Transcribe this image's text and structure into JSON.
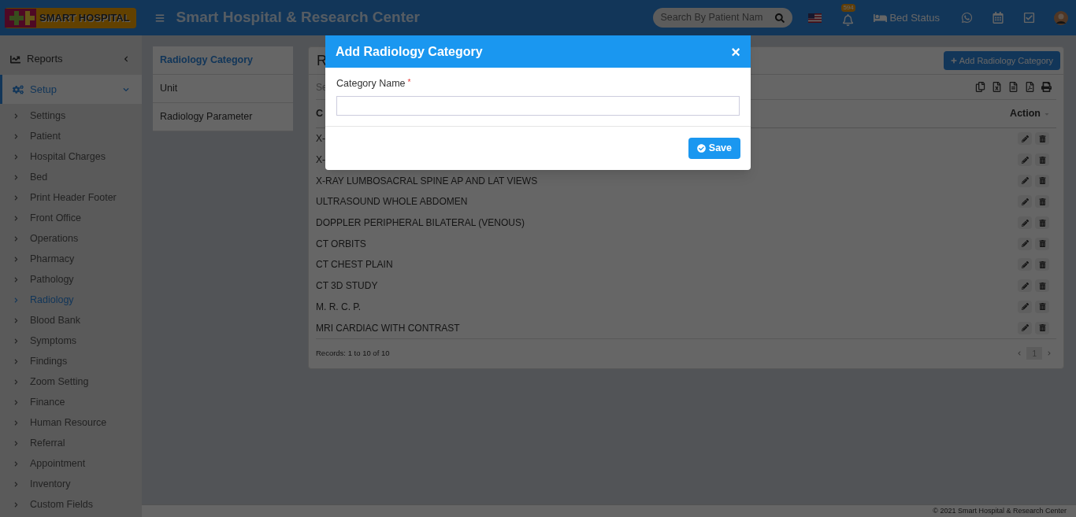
{
  "header": {
    "logo": "SMART HOSPITAL",
    "title": "Smart Hospital & Research Center",
    "search": {
      "placeholder": "Search By Patient Nam"
    },
    "notification_count": "594",
    "bed_status": "Bed Status"
  },
  "sidebar": {
    "items": [
      {
        "label": "Reports",
        "expanded": false,
        "selected": false
      },
      {
        "label": "Setup",
        "expanded": true,
        "selected": true,
        "children": [
          {
            "label": "Settings",
            "selected": false
          },
          {
            "label": "Patient",
            "selected": false
          },
          {
            "label": "Hospital Charges",
            "selected": false
          },
          {
            "label": "Bed",
            "selected": false
          },
          {
            "label": "Print Header Footer",
            "selected": false
          },
          {
            "label": "Front Office",
            "selected": false
          },
          {
            "label": "Operations",
            "selected": false
          },
          {
            "label": "Pharmacy",
            "selected": false
          },
          {
            "label": "Pathology",
            "selected": false
          },
          {
            "label": "Radiology",
            "selected": true
          },
          {
            "label": "Blood Bank",
            "selected": false
          },
          {
            "label": "Symptoms",
            "selected": false
          },
          {
            "label": "Findings",
            "selected": false
          },
          {
            "label": "Zoom Setting",
            "selected": false
          },
          {
            "label": "Finance",
            "selected": false
          },
          {
            "label": "Human Resource",
            "selected": false
          },
          {
            "label": "Referral",
            "selected": false
          },
          {
            "label": "Appointment",
            "selected": false
          },
          {
            "label": "Inventory",
            "selected": false
          },
          {
            "label": "Custom Fields",
            "selected": false
          }
        ]
      }
    ]
  },
  "submenu": [
    {
      "label": "Radiology Category",
      "selected": true
    },
    {
      "label": "Unit",
      "selected": false
    },
    {
      "label": "Radiology Parameter",
      "selected": false
    }
  ],
  "panel": {
    "title": "R",
    "add_button": "Add Radiology Category",
    "search_placeholder": "Se",
    "columns": [
      "C",
      "Action"
    ],
    "rows": [
      {
        "name": "X-"
      },
      {
        "name": "X-"
      },
      {
        "name": "X-RAY LUMBOSACRAL SPINE AP AND LAT VIEWS"
      },
      {
        "name": "ULTRASOUND WHOLE ABDOMEN"
      },
      {
        "name": "DOPPLER PERIPHERAL BILATERAL (VENOUS)"
      },
      {
        "name": "CT ORBITS"
      },
      {
        "name": "CT CHEST PLAIN"
      },
      {
        "name": "CT 3D STUDY"
      },
      {
        "name": "M. R. C. P."
      },
      {
        "name": "MRI CARDIAC WITH CONTRAST"
      }
    ],
    "records": "Records: 1 to 10 of 10",
    "page": "1"
  },
  "modal": {
    "title": "Add Radiology Category",
    "close": "×",
    "field_label": "Category Name",
    "required_mark": "*",
    "save_button": "Save"
  },
  "footer": "© 2021 Smart Hospital & Research Center"
}
